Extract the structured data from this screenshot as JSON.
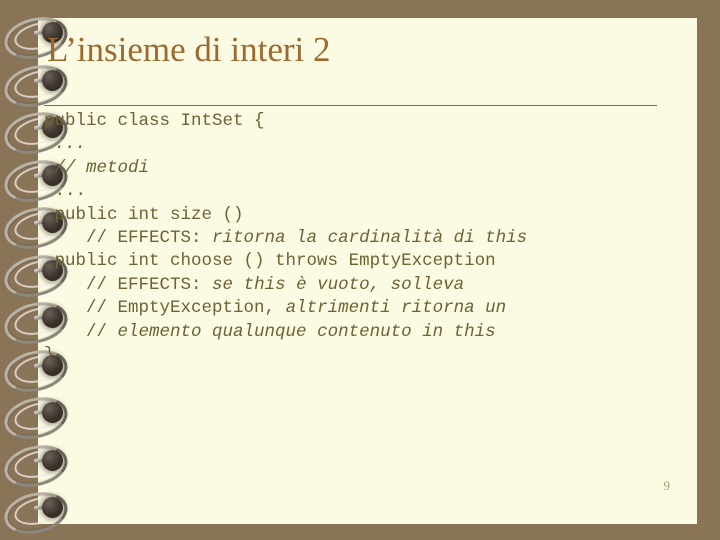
{
  "theme": {
    "background_color": "#8a7458",
    "page_color": "#fbfae2",
    "title_color": "#9c6a31",
    "code_color": "#6e6236",
    "rule_color": "#7d6a4d",
    "page_number_color": "#a9a07c"
  },
  "slide": {
    "title": "L’insieme di interi 2",
    "page_number": "9",
    "code_lines": [
      {
        "indent": 0,
        "segments": [
          {
            "text": "public class IntSet {",
            "italic": false
          }
        ]
      },
      {
        "indent": 1,
        "segments": [
          {
            "text": "...",
            "italic": true
          }
        ]
      },
      {
        "indent": 1,
        "segments": [
          {
            "text": "// metodi",
            "italic": true
          }
        ]
      },
      {
        "indent": 1,
        "segments": [
          {
            "text": "...",
            "italic": false
          }
        ]
      },
      {
        "indent": 1,
        "segments": [
          {
            "text": "public int size ()",
            "italic": false
          }
        ]
      },
      {
        "indent": 4,
        "segments": [
          {
            "text": "// EFFECTS: ",
            "italic": false
          },
          {
            "text": "ritorna la cardinalità di this",
            "italic": true
          }
        ]
      },
      {
        "indent": 1,
        "segments": [
          {
            "text": "public int choose () throws EmptyException",
            "italic": false
          }
        ]
      },
      {
        "indent": 4,
        "segments": [
          {
            "text": "// EFFECTS: ",
            "italic": false
          },
          {
            "text": "se ",
            "italic": true
          },
          {
            "text": "this",
            "italic": true
          },
          {
            "text": " è vuoto, solleva",
            "italic": true
          }
        ]
      },
      {
        "indent": 4,
        "segments": [
          {
            "text": "// EmptyException, ",
            "italic": false
          },
          {
            "text": "altrimenti ritorna un",
            "italic": true
          }
        ]
      },
      {
        "indent": 4,
        "segments": [
          {
            "text": "// ",
            "italic": false
          },
          {
            "text": "elemento qualunque contenuto in this",
            "italic": true
          }
        ]
      },
      {
        "indent": 0,
        "segments": [
          {
            "text": "}",
            "italic": false
          }
        ]
      }
    ],
    "binding": {
      "icon": "spiral-binding-icon",
      "coil_count": 11
    }
  }
}
